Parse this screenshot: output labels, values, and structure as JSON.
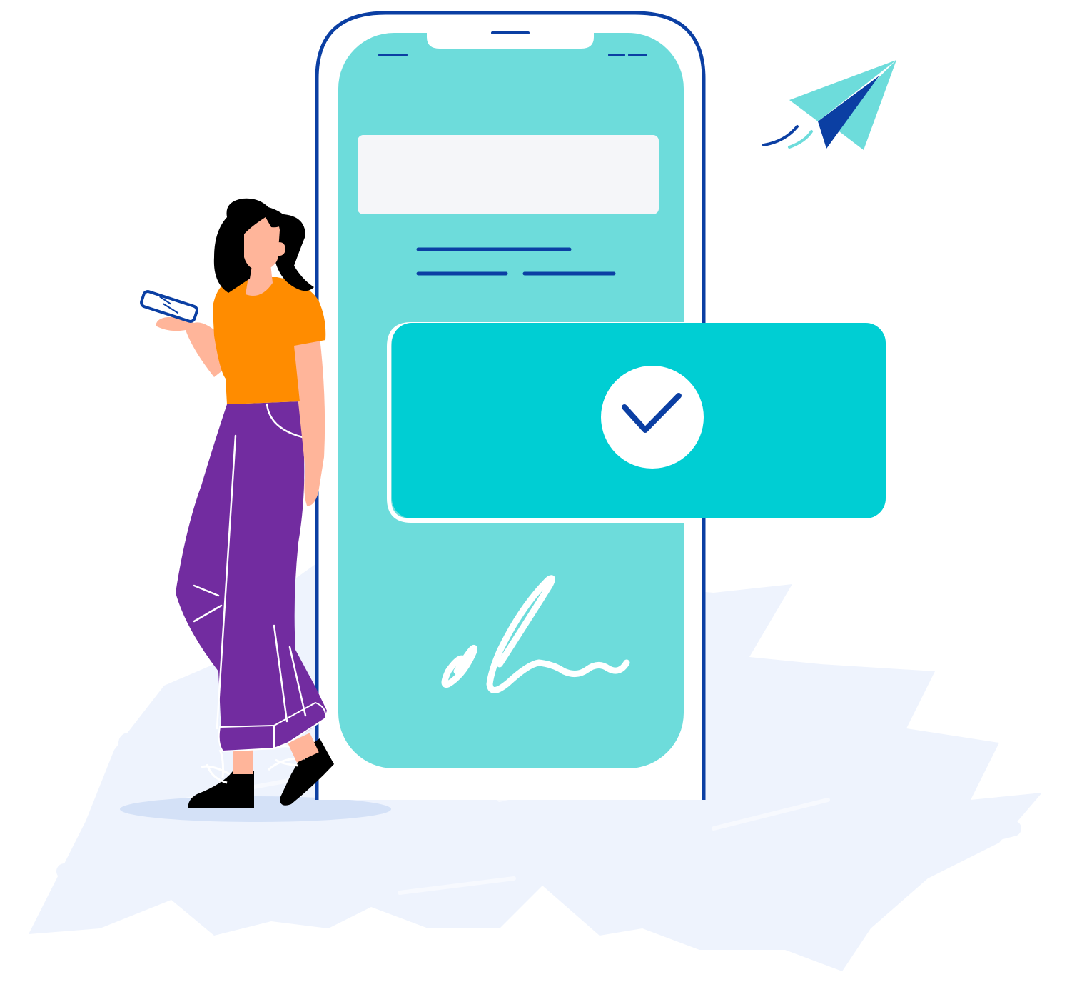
{
  "illustration": {
    "colors": {
      "background": "#ffffff",
      "brush_fill": "#eef3fd",
      "phone_outline": "#0b3fa3",
      "phone_screen": "#6ddcdb",
      "screen_card": "#f5f6f9",
      "text_line": "#0b3fa3",
      "confirm_card": "#00ced3",
      "check_circle": "#ffffff",
      "check_mark": "#0b3fa3",
      "signature": "#ffffff",
      "plane_light": "#6ddcdb",
      "plane_dark": "#0b3fa3",
      "hair": "#000000",
      "skin": "#ffb59a",
      "shirt": "#ff8c00",
      "pants": "#722ca0",
      "shoes": "#000000",
      "floor_shadow": "#d4e1f7"
    },
    "icons": [
      "paper-plane-icon",
      "check-circle-icon",
      "signature-icon"
    ]
  }
}
